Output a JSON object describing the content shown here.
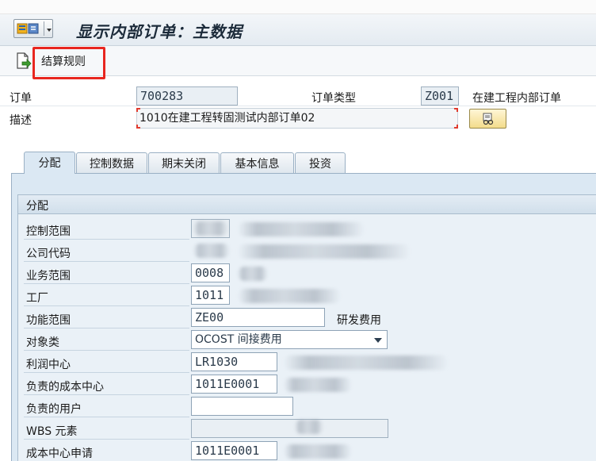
{
  "header": {
    "title": "显示内部订单：主数据"
  },
  "toolbar": {
    "settlement_rule_label": "结算规则"
  },
  "order": {
    "order_label": "订单",
    "order_value": "700283",
    "order_type_label": "订单类型",
    "order_type_value": "Z001",
    "order_type_text": "在建工程内部订单",
    "description_label": "描述",
    "description_value": "1010在建工程转固测试内部订单02"
  },
  "tabs": [
    {
      "label": "分配",
      "active": true
    },
    {
      "label": "控制数据",
      "active": false
    },
    {
      "label": "期末关闭",
      "active": false
    },
    {
      "label": "基本信息",
      "active": false
    },
    {
      "label": "投资",
      "active": false
    }
  ],
  "assignment": {
    "group_title": "分配",
    "fields": [
      {
        "label": "控制范围",
        "value": "",
        "text": ""
      },
      {
        "label": "公司代码",
        "value": "",
        "text": ""
      },
      {
        "label": "业务范围",
        "value": "0008",
        "text": ""
      },
      {
        "label": "工厂",
        "value": "1011",
        "text": ""
      },
      {
        "label": "功能范围",
        "value": "ZE00",
        "text": "研发费用"
      },
      {
        "label": "对象类",
        "value": "OCOST  间接费用",
        "text": ""
      },
      {
        "label": "利润中心",
        "value": "LR1030",
        "text": ""
      },
      {
        "label": "负责的成本中心",
        "value": "1011E0001",
        "text": ""
      },
      {
        "label": "负责的用户",
        "value": "",
        "text": ""
      },
      {
        "label": "WBS 元素",
        "value": "",
        "text": ""
      },
      {
        "label": "成本中心申请",
        "value": "1011E0001",
        "text": ""
      }
    ]
  },
  "colors": {
    "accent_red": "#e8261f",
    "panel_blue": "#dbe8f3"
  }
}
